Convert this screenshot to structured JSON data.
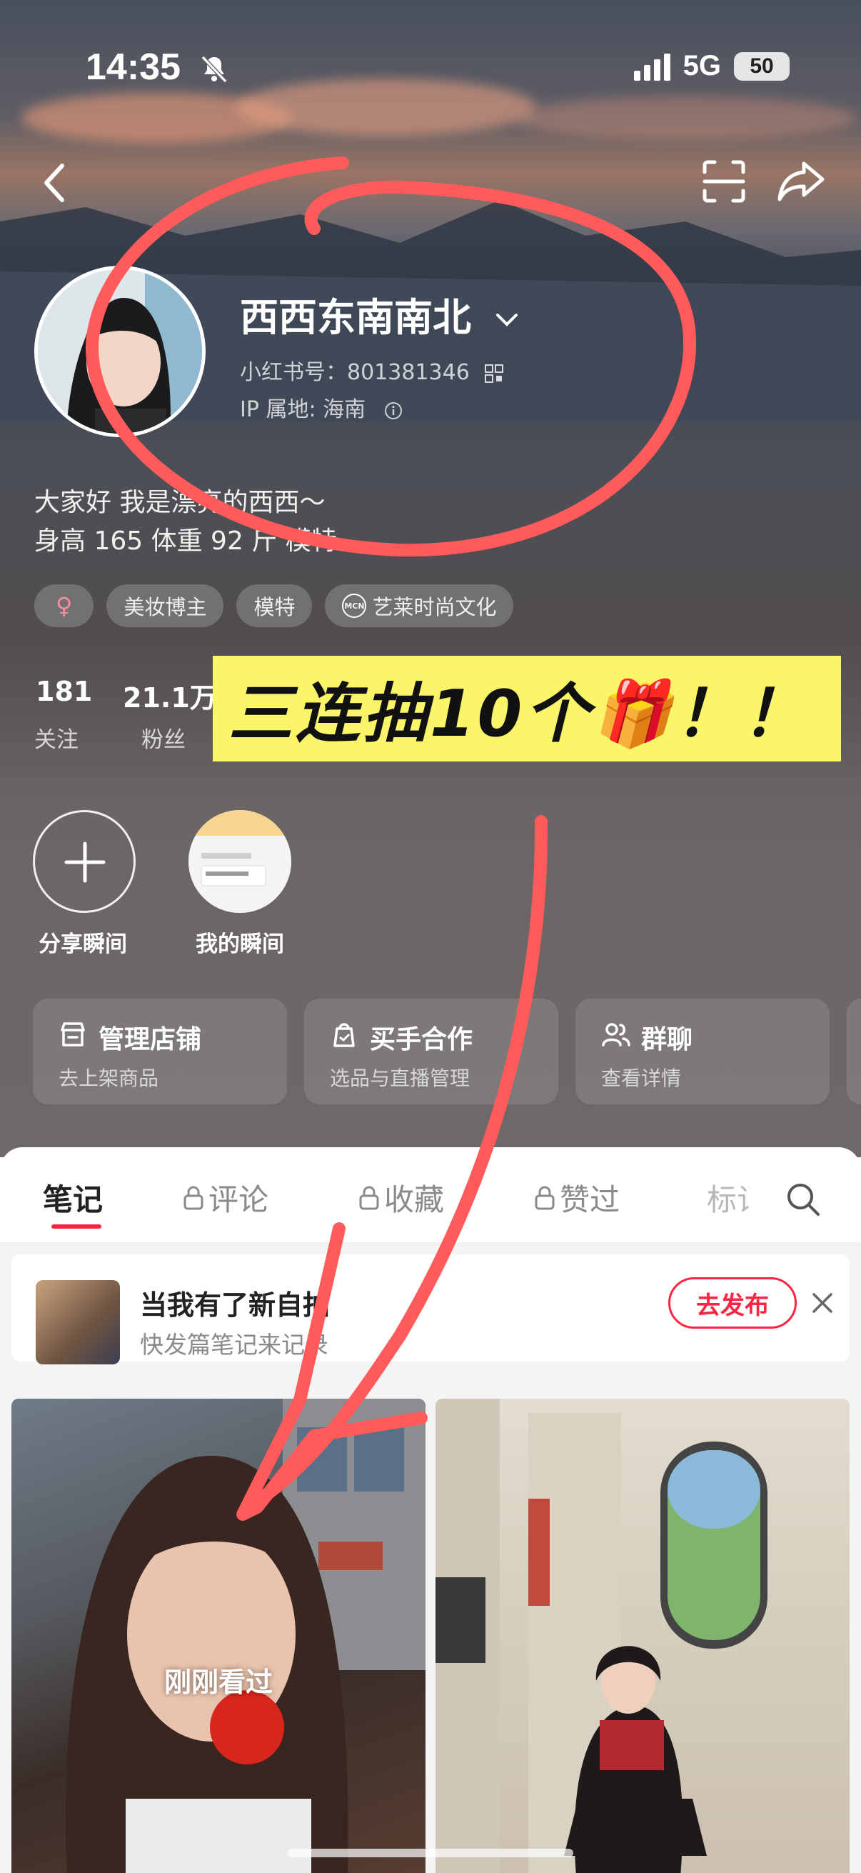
{
  "status_bar": {
    "time": "14:35",
    "network": "5G",
    "battery": "50"
  },
  "profile": {
    "name": "西西东南南北",
    "xhs_id": "小红书号：801381346",
    "ip_location": "IP 属地: 海南",
    "bio_line1": "大家好 我是漂亮的西西～",
    "bio_line2": "身高 165 体重 92 斤 模特",
    "tags": [
      {
        "label": "♀",
        "icon": "female-icon"
      },
      {
        "label": "美妆博主"
      },
      {
        "label": "模特"
      },
      {
        "label": "艺莱时尚文化",
        "icon": "mcn-icon"
      }
    ],
    "stats": [
      {
        "value": "181",
        "label": "关注"
      },
      {
        "value": "21.1万",
        "label": "粉丝"
      }
    ]
  },
  "banner": {
    "text": "三连抽10个🎁！！"
  },
  "moments": [
    {
      "label": "分享瞬间",
      "icon": "plus-icon"
    },
    {
      "label": "我的瞬间"
    }
  ],
  "tools": [
    {
      "title": "管理店铺",
      "subtitle": "去上架商品",
      "icon": "store-icon"
    },
    {
      "title": "买手合作",
      "subtitle": "选品与直播管理",
      "icon": "bag-icon"
    },
    {
      "title": "群聊",
      "subtitle": "查看详情",
      "icon": "group-icon"
    }
  ],
  "tabs": [
    {
      "label": "笔记",
      "active": true
    },
    {
      "label": "评论",
      "locked": true
    },
    {
      "label": "收藏",
      "locked": true
    },
    {
      "label": "赞过",
      "locked": true
    },
    {
      "label": "标记"
    }
  ],
  "prompt": {
    "title": "当我有了新自拍",
    "subtitle": "快发篇笔记来记录",
    "button": "去发布"
  },
  "notes": [
    {
      "overlay_text": "刚刚看过"
    },
    {
      "overlay_text": ""
    }
  ],
  "colors": {
    "accent": "#ff2442",
    "annotation": "#ff5b5b",
    "banner": "#fbf56a"
  }
}
